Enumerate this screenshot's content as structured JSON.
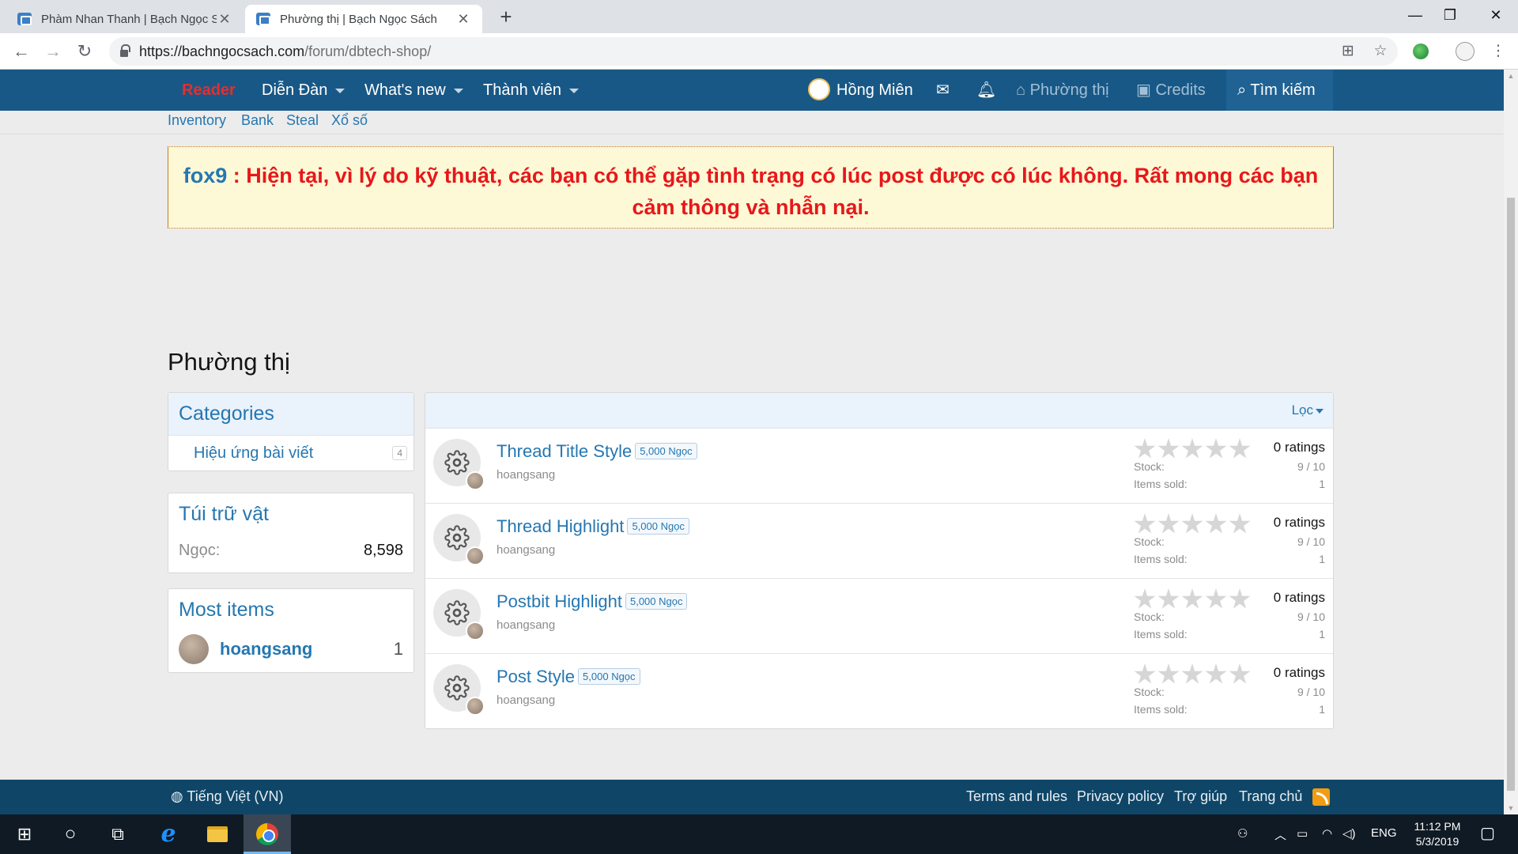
{
  "browser": {
    "tabs": [
      {
        "title": "Phàm Nhan Thanh | Bạch Ngọc Sách",
        "active": false
      },
      {
        "title": "Phường thị | Bạch Ngọc Sách",
        "active": true
      }
    ],
    "new_tab": "+",
    "url_host": "https://bachngocsach.com",
    "url_path": "/forum/dbtech-shop/"
  },
  "nav": {
    "reader": "Reader",
    "forums": "Diễn Đàn",
    "whats_new": "What's new",
    "members": "Thành viên",
    "user": "Hồng Miên",
    "shop": "Phường thị",
    "credits": "Credits",
    "search": "Tìm kiếm"
  },
  "subnav": [
    "Inventory",
    "Bank",
    "Steal",
    "Xổ số"
  ],
  "notice": {
    "author": "fox9",
    "message": "Hiện tại, vì lý do kỹ thuật, các bạn có thể gặp tình trạng có lúc post được có lúc không. Rất mong các bạn cảm thông và nhẫn nại."
  },
  "page_title": "Phường thị",
  "categories": {
    "heading": "Categories",
    "items": [
      {
        "label": "Hiệu ứng bài viết",
        "count": "4"
      }
    ]
  },
  "inventory": {
    "heading": "Túi trữ vật",
    "label": "Ngọc:",
    "value": "8,598"
  },
  "most_items": {
    "heading": "Most items",
    "user": "hoangsang",
    "count": "1"
  },
  "list": {
    "filter": "Lọc",
    "stock_label": "Stock:",
    "sold_label": "Items sold:",
    "items": [
      {
        "title": "Thread Title Style",
        "price": "5,000 Ngọc",
        "author": "hoangsang",
        "ratings": "0 ratings",
        "rating_value": 0,
        "stock": "9 / 10",
        "sold": "1"
      },
      {
        "title": "Thread Highlight",
        "price": "5,000 Ngọc",
        "author": "hoangsang",
        "ratings": "0 ratings",
        "rating_value": 0,
        "stock": "9 / 10",
        "sold": "1"
      },
      {
        "title": "Postbit Highlight",
        "price": "5,000 Ngọc",
        "author": "hoangsang",
        "ratings": "0 ratings",
        "rating_value": 0,
        "stock": "9 / 10",
        "sold": "1"
      },
      {
        "title": "Post Style",
        "price": "5,000 Ngọc",
        "author": "hoangsang",
        "ratings": "0 ratings",
        "rating_value": 0,
        "stock": "9 / 10",
        "sold": "1"
      }
    ]
  },
  "footer": {
    "language": "Tiếng Việt (VN)",
    "links": [
      "Terms and rules",
      "Privacy policy",
      "Trợ giúp",
      "Trang chủ"
    ]
  },
  "taskbar": {
    "lang": "ENG",
    "time": "11:12 PM",
    "date": "5/3/2019"
  },
  "colors": {
    "nav_bg": "#185886",
    "link": "#2577b1",
    "notice_text": "#e8171a",
    "footer_bg": "#0f4667"
  },
  "icons": [
    "back-icon",
    "forward-icon",
    "reload-icon",
    "lock-icon",
    "translate-icon",
    "star-icon",
    "mail-icon",
    "bell-icon",
    "basket-icon",
    "money-icon",
    "search-icon",
    "gear-icon",
    "globe-icon",
    "rss-icon",
    "windows-icon"
  ]
}
